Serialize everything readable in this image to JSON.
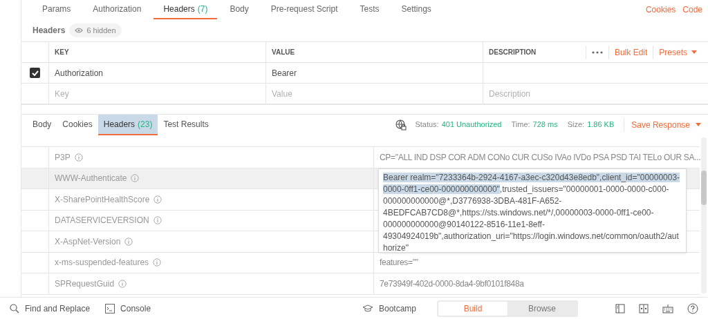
{
  "request_tabs": [
    {
      "label": "Params",
      "selected": false
    },
    {
      "label": "Authorization",
      "selected": false
    },
    {
      "label": "Headers",
      "count": "(7)",
      "selected": true
    },
    {
      "label": "Body",
      "selected": false
    },
    {
      "label": "Pre-request Script",
      "selected": false
    },
    {
      "label": "Tests",
      "selected": false
    },
    {
      "label": "Settings",
      "selected": false
    }
  ],
  "request_links": [
    "Cookies",
    "Code"
  ],
  "headers_bar": {
    "title": "Headers",
    "hidden": "6 hidden"
  },
  "request_table": {
    "columns": [
      "KEY",
      "VALUE",
      "DESCRIPTION"
    ],
    "actions": [
      "Bulk Edit",
      "Presets"
    ],
    "rows": [
      {
        "checked": true,
        "key": "Authorization",
        "value": "Bearer"
      }
    ],
    "new_row": [
      {
        "placeholder": "Key"
      },
      {
        "placeholder": "Value"
      },
      {
        "placeholder": "Description"
      }
    ]
  },
  "response_tabs": [
    {
      "label": "Body",
      "selected": false
    },
    {
      "label": "Cookies",
      "selected": false
    },
    {
      "label": "Headers",
      "count": "(23)",
      "selected": true
    },
    {
      "label": "Test Results",
      "selected": false
    }
  ],
  "response_status": [
    {
      "label": "Status:",
      "value": "401 Unauthorized"
    },
    {
      "label": "Time:",
      "value": "728 ms"
    },
    {
      "label": "Size:",
      "value": "1.86 KB"
    }
  ],
  "save_response": "Save Response",
  "response_headers": [
    {
      "key": "P3P",
      "value": "CP=\"ALL IND DSP COR ADM CONo CUR CUSo IVAo IVDo PSA PSD TAI TELo OUR SA...",
      "selected": false
    },
    {
      "key": "WWW-Authenticate",
      "selected": true
    },
    {
      "key": "X-SharePointHealthScore",
      "selected": false
    },
    {
      "key": "DATASERVICEVERSION",
      "selected": false
    },
    {
      "key": "X-AspNet-Version",
      "selected": false
    },
    {
      "key": "x-ms-suspended-features",
      "value": "features=\"\"",
      "selected": false
    },
    {
      "key": "SPRequestGuid",
      "value": "7e73949f-402d-0000-8da4-9bf0101f848a",
      "selected": false
    }
  ],
  "value_popup": {
    "selected_text": "Bearer realm=\"7233364b-2924-4167-a3ec-c320d43e8edb\",client_id=\"00000003-0000-0ff1-ce00-000000000000\"",
    "rest_text": ",trusted_issuers=\"00000001-0000-0000-c000-000000000000@*,D3776938-3DBA-481F-A652-4BEDFCAB7CD8@*,https://sts.windows.net/*/,00000003-0000-0ff1-ce00-000000000000@90140122-8516-11e1-8eff-49304924019b\",authorization_uri=\"https://login.windows.net/common/oauth2/authorize\""
  },
  "footer": {
    "left": [
      "Find and Replace",
      "Console"
    ],
    "bootcamp": "Bootcamp",
    "modes": [
      {
        "label": "Build",
        "selected": true
      },
      {
        "label": "Browse",
        "selected": false
      }
    ]
  }
}
